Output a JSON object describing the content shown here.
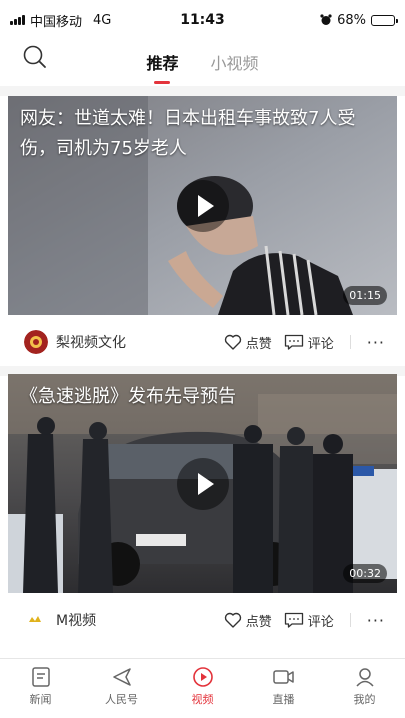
{
  "status_bar": {
    "carrier": "中国移动",
    "network": "4G",
    "time": "11:43",
    "battery": "68%",
    "battery_level": 0.68
  },
  "header": {
    "search_icon": "search-icon",
    "tabs": [
      {
        "label": "推荐",
        "active": true
      },
      {
        "label": "小视频",
        "active": false
      }
    ]
  },
  "feed": [
    {
      "title": "网友：世道太难！日本出租车事故致7人受伤，司机为75岁老人",
      "duration": "01:15",
      "source": "梨视频文化",
      "like_label": "点赞",
      "comment_label": "评论",
      "more": "···"
    },
    {
      "title": "《急速逃脱》发布先导预告",
      "duration": "00:32",
      "source": "M视频",
      "like_label": "点赞",
      "comment_label": "评论",
      "more": "···"
    }
  ],
  "tabbar": [
    {
      "label": "新闻",
      "icon": "news-icon",
      "active": false
    },
    {
      "label": "人民号",
      "icon": "paper-plane-icon",
      "active": false
    },
    {
      "label": "视频",
      "icon": "play-circle-icon",
      "active": true
    },
    {
      "label": "直播",
      "icon": "video-camera-icon",
      "active": false
    },
    {
      "label": "我的",
      "icon": "user-icon",
      "active": false
    }
  ],
  "colors": {
    "accent": "#e3333b"
  }
}
